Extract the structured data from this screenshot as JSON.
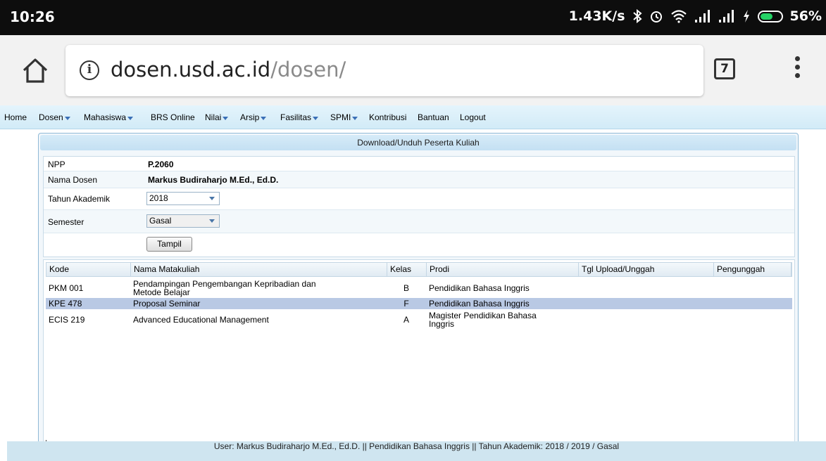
{
  "status_bar": {
    "time": "10:26",
    "network_speed": "1.43K/s",
    "icons": [
      "bluetooth-icon",
      "alarm-icon",
      "wifi-icon",
      "signal-icon",
      "signal-icon",
      "charging-icon"
    ],
    "battery": "56%",
    "battery_level": 0.56
  },
  "browser": {
    "domain": "dosen.usd.ac.id",
    "path": "/dosen/",
    "tab_count": "7"
  },
  "menu": [
    {
      "label": "Home",
      "dropdown": false
    },
    {
      "label": "Dosen",
      "dropdown": true
    },
    {
      "label": "Mahasiswa",
      "dropdown": true
    },
    {
      "label": "BRS Online",
      "dropdown": false
    },
    {
      "label": "Nilai",
      "dropdown": true
    },
    {
      "label": "Arsip",
      "dropdown": true
    },
    {
      "label": "Fasilitas",
      "dropdown": true
    },
    {
      "label": "SPMI",
      "dropdown": true
    },
    {
      "label": "Kontribusi",
      "dropdown": false
    },
    {
      "label": "Bantuan",
      "dropdown": false
    },
    {
      "label": "Logout",
      "dropdown": false
    }
  ],
  "panel": {
    "title": "Download/Unduh Peserta Kuliah"
  },
  "form": {
    "npp_label": "NPP",
    "npp_value": "P.2060",
    "nama_label": "Nama Dosen",
    "nama_value": "Markus Budiraharjo M.Ed., Ed.D.",
    "tahun_label": "Tahun Akademik",
    "tahun_value": "2018",
    "semester_label": "Semester",
    "semester_value": "Gasal",
    "tampil_label": "Tampil"
  },
  "table": {
    "headers": [
      "Kode",
      "Nama Matakuliah",
      "Kelas",
      "Prodi",
      "Tgl Upload/Unggah",
      "Pengunggah"
    ],
    "rows": [
      {
        "kode": "PKM 001",
        "nama": [
          "Pendampingan Pengembangan Kepribadian dan",
          "Metode Belajar"
        ],
        "kelas": "B",
        "prodi": [
          "Pendidikan Bahasa Inggris"
        ],
        "tgl": "",
        "pengunggah": "",
        "selected": false
      },
      {
        "kode": "KPE 478",
        "nama": [
          "Proposal Seminar"
        ],
        "kelas": "F",
        "prodi": [
          "Pendidikan Bahasa Inggris"
        ],
        "tgl": "",
        "pengunggah": "",
        "selected": true
      },
      {
        "kode": "ECIS 219",
        "nama": [
          "Advanced Educational Management"
        ],
        "kelas": "A",
        "prodi": [
          "Magister Pendidikan Bahasa",
          "Inggris"
        ],
        "tgl": "",
        "pengunggah": "",
        "selected": false
      }
    ]
  },
  "footer": {
    "text": "User: Markus Budiraharjo M.Ed., Ed.D. || Pendidikan Bahasa Inggris || Tahun Akademik: 2018 / 2019 / Gasal"
  },
  "colors": {
    "status_bar": "#0d0d0d",
    "menu_bg": "#d2ebf7",
    "selected_row": "#b9c9e4",
    "footer_bg": "#cfe5f0"
  }
}
